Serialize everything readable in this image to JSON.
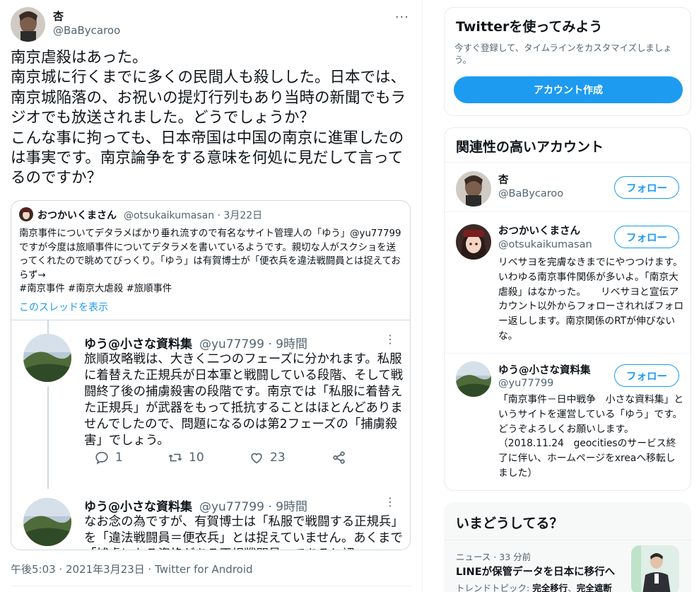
{
  "tweet": {
    "author_name": "杏",
    "author_handle": "@BaBycaroo",
    "text": "南京虐殺はあった。\n南京城に行くまでに多くの民間人も殺しした。日本では、南京城陥落の、お祝いの提灯行列もあり当時の新聞でもラジオでも放送されました。どうでしょうか？\nこんな事に拘っても、日本帝国は中国の南京に進軍したのは事実です。南京論争をする意味を何処に見だして言ってるのですか？",
    "timestamp": "午後5:03 · 2021年3月23日 · Twitter for Android"
  },
  "quote": {
    "author_name": "おつかいくまさん",
    "meta": "@otsukaikumasan · 3月22日",
    "text": "南京事件についてデタラメばかり垂れ流すので有名なサイト管理人の「ゆう」@yu77799ですが今度は旅順事件についてデタラメを書いているようです。親切な人がスクショを送ってくれたので眺めてびっくり。「ゆう」は有賀博士が「便衣兵を違法戦闘員とは捉えておらず→\n#南京事件 #南京大虐殺 #旅順事件",
    "thread_link": "このスレッドを表示",
    "thread": [
      {
        "name": "ゆう@小さな資料集",
        "meta": "@yu77799 · 9時間",
        "text": "旅順攻略戦は、大きく二つのフェーズに分かれます。私服に着替えた正規兵が日本軍と戦闘している段階、そして戦闘終了後の捕虜殺害の段階です。南京では「私服に着替えた正規兵」が武器をもって抵抗することはほとんどありませんでしたので、問題になるのは第2フェーズの「捕虜殺害」でしょう。",
        "replies": "1",
        "retweets": "10",
        "likes": "23"
      },
      {
        "name": "ゆう@小さな資料集",
        "meta": "@yu77799 · 9時間",
        "text": "なお念の為ですが、有賀博士は「私服で戦闘する正規兵」を「違法戦闘員＝便衣兵」とは捉えていません。あくまで「捕虜になる資格がある正規戦闘員」であると認"
      }
    ]
  },
  "sidebar": {
    "signup": {
      "title": "Twitterを使ってみよう",
      "desc": "今すぐ登録して、タイムラインをカスタマイズしましょう。",
      "button": "アカウント作成"
    },
    "relevant": {
      "title": "関連性の高いアカウント",
      "follow_label": "フォロー",
      "accounts": [
        {
          "name": "杏",
          "handle": "@BaBycaroo",
          "bio": ""
        },
        {
          "name": "おつかいくまさん",
          "handle": "@otsukaikumasan",
          "bio": "リベサヨを完膚なきまでにやつつけます。いわゆる南京事件関係が多いよ。「南京大虐殺」はなかった。　　リベサヨと宣伝アカウント以外からフォローされればフォロー返しします。南京関係のRTが伸びないな。"
        },
        {
          "name": "ゆう@小さな資料集",
          "handle": "@yu77799",
          "bio": "「南京事件－日中戦争　小さな資料集」というサイトを運営している「ゆう」です。どうぞよろしくお願いします。（2018.11.24　geocitiesのサービス終了に伴い、ホームページをxreaへ移転しました）"
        }
      ]
    },
    "trends": {
      "title": "いまどうしてる？",
      "meta": "ニュース · 33 分前",
      "headline": "LINEが保管データを日本に移行へ",
      "topics_label": "トレンドトピック:",
      "topic1": "完全移行",
      "topic2": "完全遮断"
    }
  },
  "colors": {
    "accent": "#1d9bf0",
    "secondary_text": "#536471",
    "border": "#cfd9de"
  },
  "icons": [
    "more-icon",
    "reply-icon",
    "retweet-icon",
    "like-icon",
    "share-icon"
  ]
}
